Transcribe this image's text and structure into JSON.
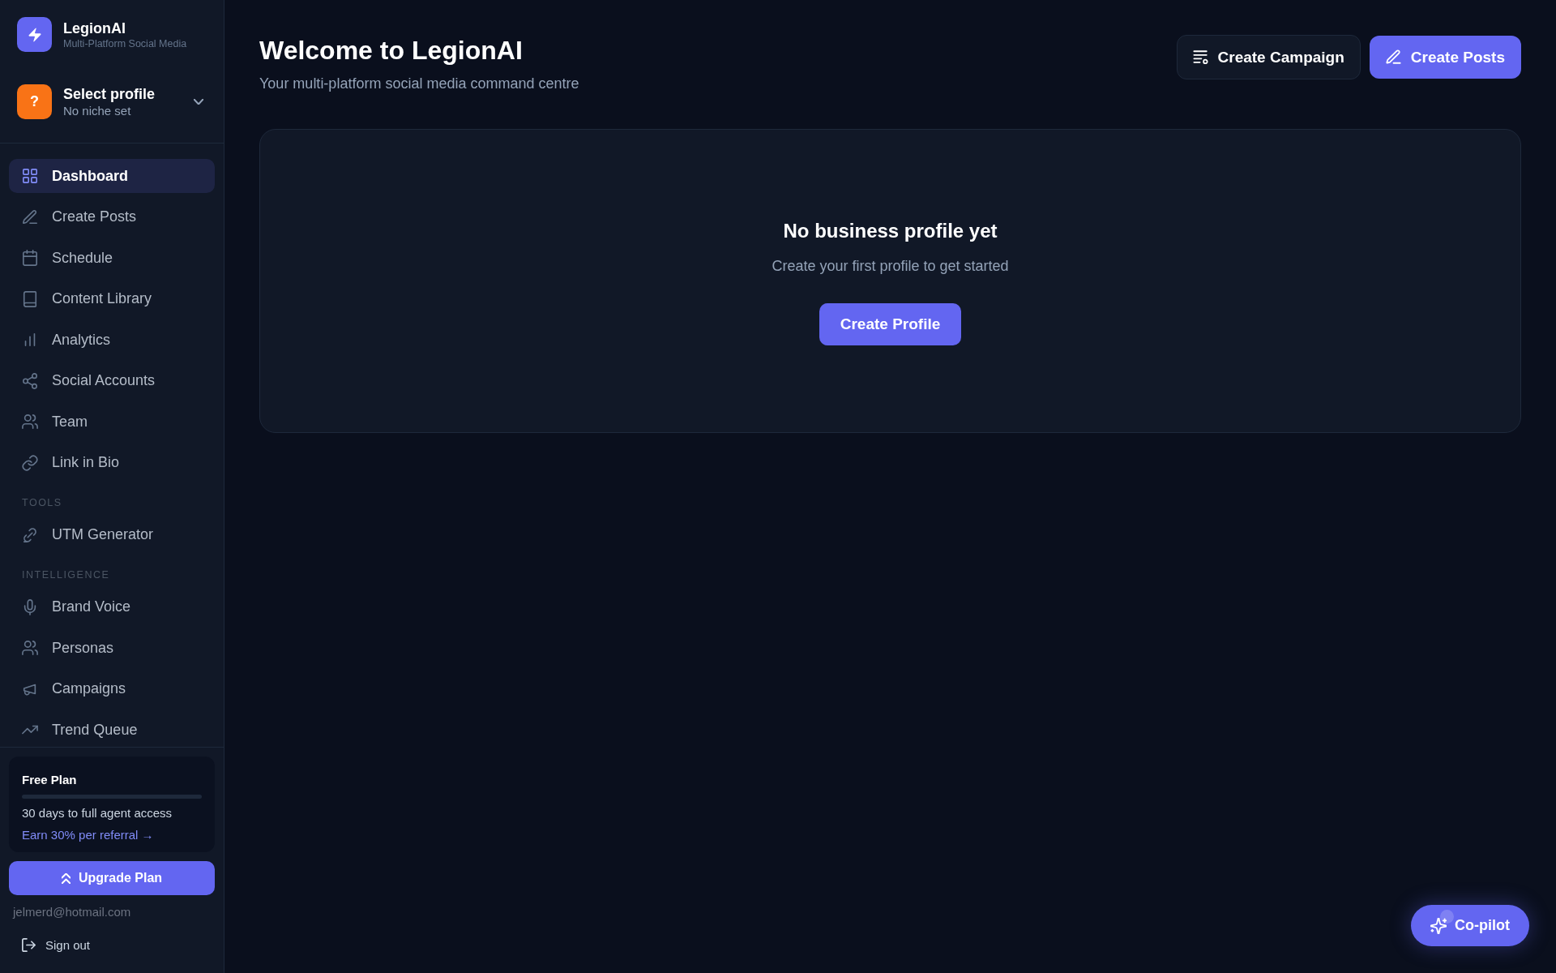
{
  "sidebar": {
    "brand": {
      "name": "LegionAI",
      "tagline": "Multi-Platform Social Media"
    },
    "profile": {
      "badge": "?",
      "name": "Select profile",
      "niche": "No niche set"
    },
    "nav": [
      {
        "label": "Dashboard",
        "selected": true
      },
      {
        "label": "Create Posts",
        "selected": false
      },
      {
        "label": "Schedule",
        "selected": false
      },
      {
        "label": "Content Library",
        "selected": false
      },
      {
        "label": "Analytics",
        "selected": false
      },
      {
        "label": "Social Accounts",
        "selected": false
      },
      {
        "label": "Team",
        "selected": false
      },
      {
        "label": "Link in Bio",
        "selected": false
      }
    ],
    "sections": [
      {
        "heading": "TOOLS",
        "items": [
          {
            "label": "UTM Generator",
            "selected": false
          }
        ]
      },
      {
        "heading": "INTELLIGENCE",
        "items": [
          {
            "label": "Brand Voice",
            "selected": false
          },
          {
            "label": "Personas",
            "selected": false
          },
          {
            "label": "Campaigns",
            "selected": false
          },
          {
            "label": "Trend Queue",
            "selected": false
          }
        ]
      }
    ],
    "plan": {
      "title": "Free Plan",
      "level": 0,
      "note": "30 days to full agent access",
      "link": "Earn 30% per referral →"
    },
    "upgrade_button": "Upgrade Plan",
    "email": "jelmerd@hotmail.com",
    "sign_out": "Sign out"
  },
  "header": {
    "title": "Welcome to LegionAI",
    "subtitle": "Your multi-platform social media command centre",
    "actions": [
      {
        "label": "Create Campaign",
        "kind": "secondary"
      },
      {
        "label": "Create Posts",
        "kind": "primary"
      }
    ]
  },
  "empty_state": {
    "title": "No business profile yet",
    "text": "Create your first profile to get started",
    "button": "Create Profile"
  },
  "copilot_button": "Co-pilot"
}
